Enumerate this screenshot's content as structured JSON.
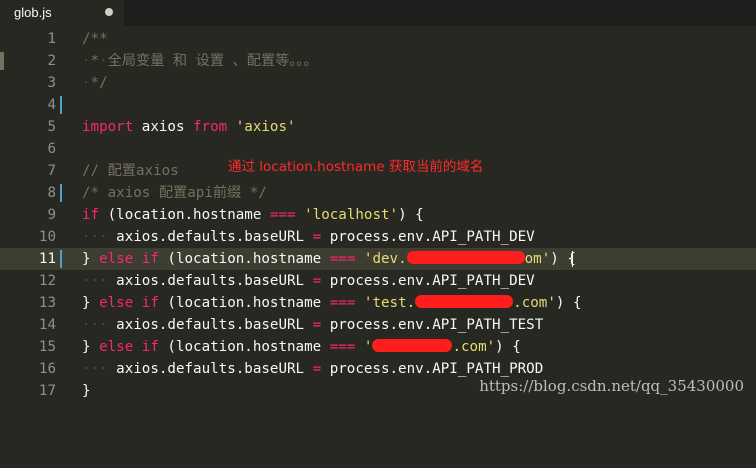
{
  "tab": {
    "title": "glob.js"
  },
  "annotation": "通过 location.hostname 获取当前的域名",
  "watermark": "https://blog.csdn.net/qq_35430000",
  "lines": {
    "n1": "1",
    "n2": "2",
    "n3": "3",
    "n4": "4",
    "n5": "5",
    "n6": "6",
    "n7": "7",
    "n8": "8",
    "n9": "9",
    "n10": "10",
    "n11": "11",
    "n12": "12",
    "n13": "13",
    "n14": "14",
    "n15": "15",
    "n16": "16",
    "n17": "17"
  },
  "code": {
    "l1": "/**",
    "l2_star": "*",
    "l2_text": "全局变量 和 设置 、配置等。。。",
    "l3": "*/",
    "l5_import": "import",
    "l5_axios": " axios ",
    "l5_from": "from",
    "l5_str": "'axios'",
    "l7": "// 配置axios",
    "l8": "/* axios 配置api前缀 */",
    "if": "if",
    "else_if": "else if",
    "cond_head": " (location.hostname ",
    "eq": "===",
    "l9_str": "'localhost'",
    "cond_tail": ") {",
    "brace_close": "} ",
    "stmt_head": "axios.defaults.baseURL ",
    "assign": "=",
    "l10_val": " process.env.API_PATH_DEV",
    "l11_str_a": "'dev.",
    "l11_str_b": "om'",
    "l12_val": " process.env.API_PATH_DEV",
    "l13_str_a": "'test.",
    "l13_str_b": ".com'",
    "l14_val": " process.env.API_PATH_TEST",
    "l15_str_a": "'",
    "l15_str_b": ".com'",
    "l16_val": " process.env.API_PATH_PROD",
    "l17": "}"
  }
}
